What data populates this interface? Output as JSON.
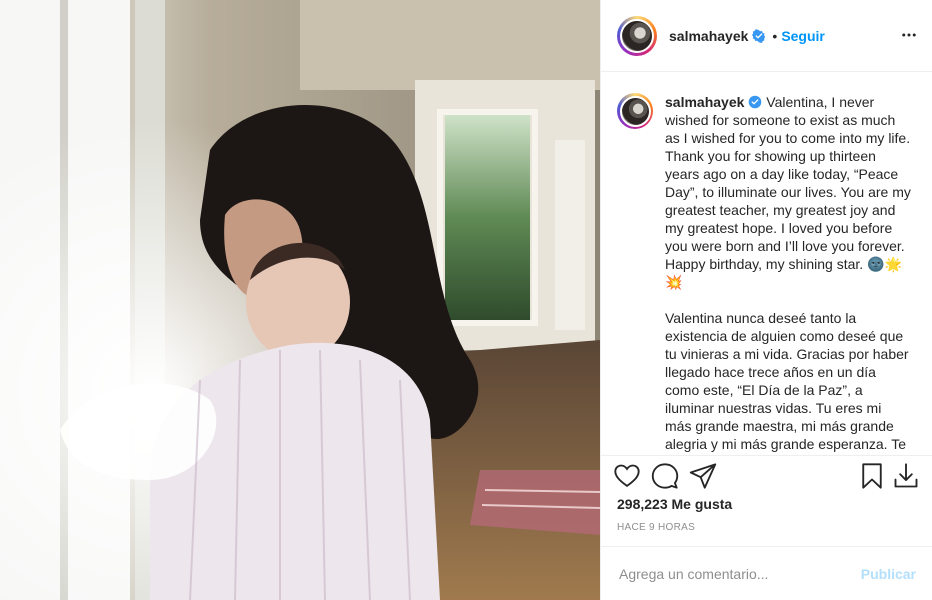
{
  "post": {
    "username": "salmahayek",
    "verified": true,
    "follow_label": "Seguir",
    "separator": "•",
    "caption_en": "Valentina, I never wished for someone to exist as much as I wished for you to come into my life. Thank you for showing up thirteen years ago on a day like today, “Peace Day”, to illuminate our lives. You are my greatest teacher, my greatest joy and my greatest hope. I loved you before you were born and I’ll love you forever. Happy birthday, my shining star. 🌚🌟💥",
    "caption_es": "Valentina nunca deseé tanto la existencia de alguien como deseé que tu vinieras a mi vida. Gracias por haber llegado hace trece años en un día como este, “El Día de la Paz”, a iluminar nuestras vidas. Tu eres mi más grande maestra, mi más grande alegria y mi más grande esperanza. Te amé antes",
    "likes": "298,223 Me gusta",
    "time": "HACE 9 HORAS"
  },
  "comment_box": {
    "placeholder": "Agrega un comentario...",
    "publish_label": "Publicar"
  },
  "icons": {
    "more": "more-options-icon",
    "like": "heart-icon",
    "comment": "comment-icon",
    "share": "paper-plane-icon",
    "save": "bookmark-icon",
    "download": "download-icon",
    "verified": "verified-badge-icon"
  },
  "colors": {
    "accent": "#0095f6",
    "publish_disabled": "#b2dffc",
    "verified": "#3897f0",
    "muted": "#8e8e8e"
  }
}
